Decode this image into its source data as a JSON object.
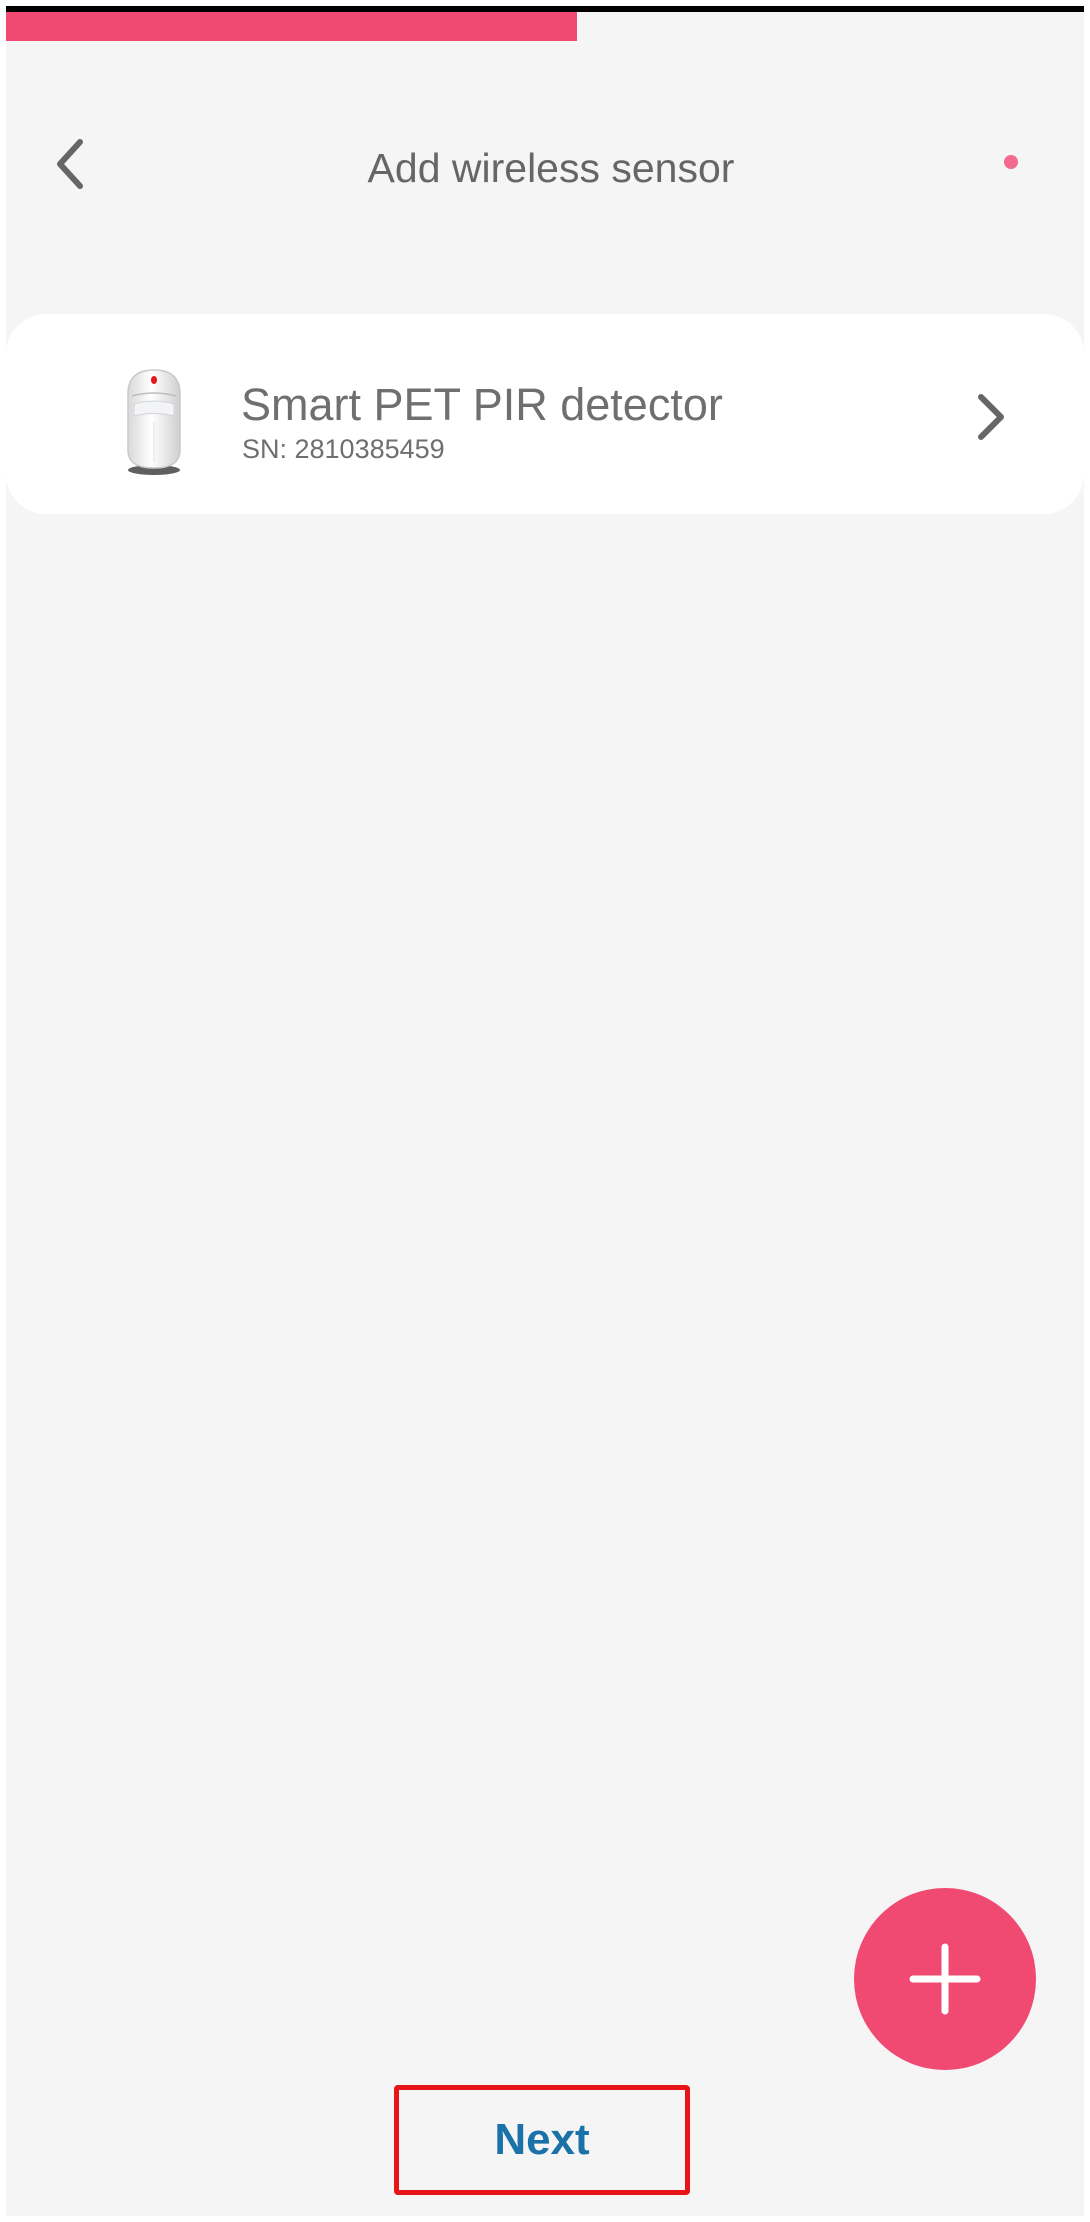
{
  "header": {
    "title": "Add wireless sensor",
    "back_icon": "chevron-left-icon",
    "status_dot_color": "#f06b8e"
  },
  "progress": {
    "fraction": 0.53,
    "color": "#f04a72"
  },
  "sensors": [
    {
      "name": "Smart PET PIR detector",
      "sn": "SN: 2810385459",
      "icon": "pir-detector-image",
      "chevron_icon": "chevron-right-icon"
    }
  ],
  "fab": {
    "icon": "plus-icon",
    "color": "#f04a72"
  },
  "footer": {
    "next_label": "Next",
    "next_color": "#1a72a8",
    "highlight_color": "#e8141a"
  }
}
